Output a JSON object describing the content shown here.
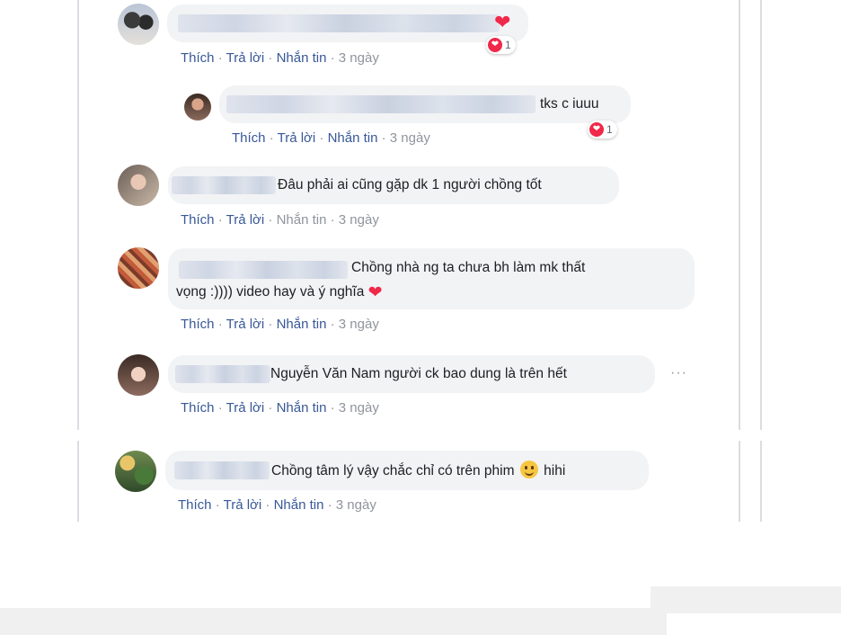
{
  "actions": {
    "like": "Thích",
    "reply": "Trả lời",
    "message": "Nhắn tin",
    "dot": "·"
  },
  "comments": [
    {
      "text": "",
      "time": "3 ngày",
      "reaction_count": "1"
    },
    {
      "text": "tks c iuuu",
      "time": "3 ngày",
      "reaction_count": "1"
    },
    {
      "text": "Đâu phải ai cũng gặp dk 1 người chồng tốt",
      "time": "3 ngày"
    },
    {
      "text_line1": "Chồng nhà ng ta chưa bh làm mk thất",
      "text_line2": "vọng :)))) video hay và ý nghĩa",
      "time": "3 ngày"
    },
    {
      "text": "Nguyễn Văn Nam người ck bao dung là trên hết",
      "time": "3 ngày",
      "more": "···"
    },
    {
      "text_before": "Chồng tâm lý vậy chắc chỉ có trên phim",
      "text_after": "hihi",
      "time": "3 ngày"
    }
  ],
  "colors": {
    "link": "#385898",
    "muted": "#90949c",
    "bubble": "#f2f3f5",
    "heart": "#f0284a"
  },
  "icons": [
    "heart-icon",
    "heart-reaction-icon",
    "smiley-icon",
    "more-options-icon"
  ]
}
